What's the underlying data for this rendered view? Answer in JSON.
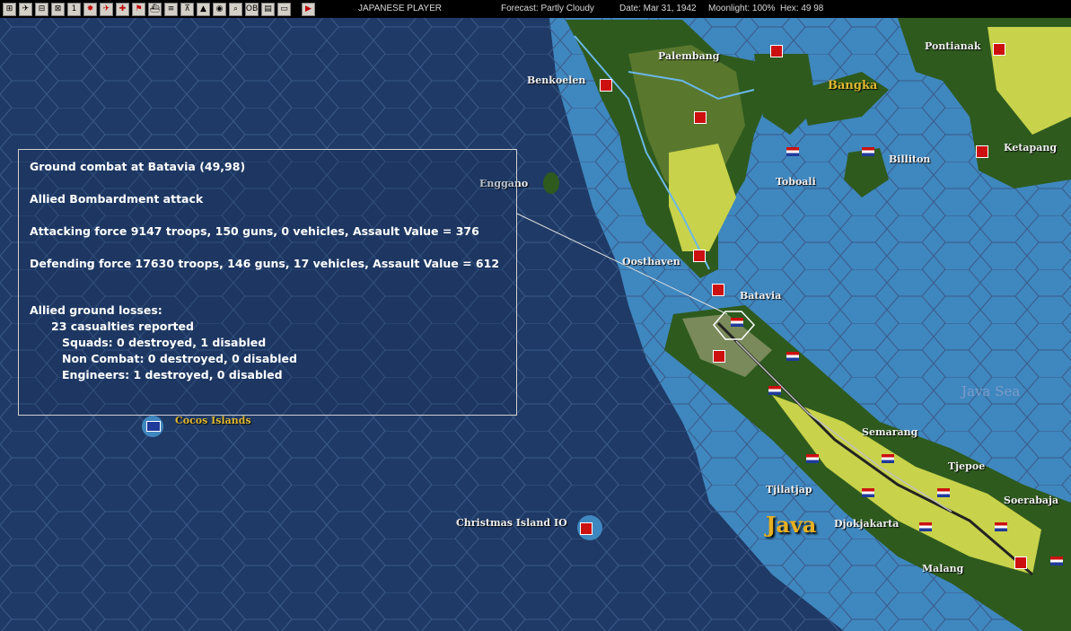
{
  "toolbar": {
    "player": "JAPANESE PLAYER",
    "forecast": "Forecast: Partly Cloudy",
    "date": "Date: Mar 31, 1942",
    "moonlight": "Moonlight: 100%",
    "hex": "Hex: 49 98",
    "buttons": [
      "1",
      "OB"
    ]
  },
  "places": {
    "palembang": "Palembang",
    "pontianak": "Pontianak",
    "benkoelen": "Benkoelen",
    "bangka": "Bangka",
    "ketapang": "Ketapang",
    "billiton": "Billiton",
    "toboali": "Toboali",
    "enggano": "Enggano",
    "oosthaven": "Oosthaven",
    "batavia": "Batavia",
    "java_sea": "Java Sea",
    "semarang": "Semarang",
    "tjepoe": "Tjepoe",
    "tjilatjap": "Tjilatjap",
    "soerabaja": "Soerabaja",
    "java": "Java",
    "djokjakarta": "Djokjakarta",
    "malang": "Malang",
    "christmas": "Christmas Island IO",
    "cocos": "Cocos Islands"
  },
  "report": {
    "title": "Ground combat at Batavia (49,98)",
    "attack_type": "Allied Bombardment attack",
    "attacking": "Attacking force 9147 troops, 150 guns, 0 vehicles, Assault Value = 376",
    "defending": "Defending force 17630 troops, 146 guns, 17 vehicles, Assault Value = 612",
    "losses_header": "Allied ground losses:",
    "casualties": "23 casualties reported",
    "squads": "Squads: 0 destroyed, 1 disabled",
    "noncombat": "Non Combat: 0 destroyed, 0 disabled",
    "engineers": "Engineers: 1 destroyed, 0 disabled"
  },
  "colors": {
    "ocean": "#1f3a66",
    "shallow": "#3f87bf",
    "jungle": "#2e5a1e",
    "clear": "#c8d24a",
    "panel_border": "#d0d0d0",
    "japan_red": "#cc1010",
    "dutch_blue": "#1f3a9a"
  }
}
